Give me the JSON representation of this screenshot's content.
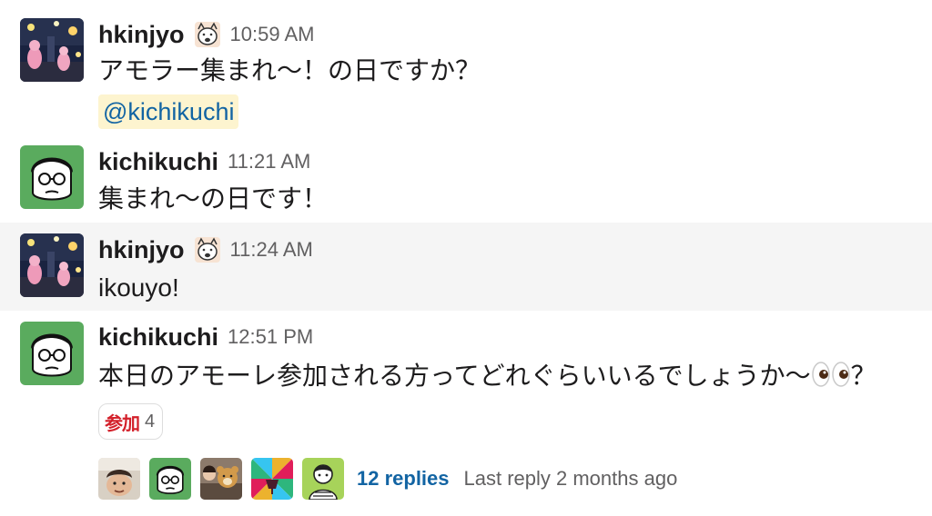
{
  "messages": [
    {
      "user": "hkinjyo",
      "time": "10:59 AM",
      "text": "アモラー集まれ〜！の日ですか？",
      "mention": "@kichikuchi"
    },
    {
      "user": "kichikuchi",
      "time": "11:21 AM",
      "text": "集まれ〜の日です！"
    },
    {
      "user": "hkinjyo",
      "time": "11:24 AM",
      "text": "ikouyo!"
    },
    {
      "user": "kichikuchi",
      "time": "12:51 PM",
      "text": "本日のアモーレ参加される方ってどれぐらいいるでしょうか〜",
      "text_suffix": "？",
      "inline_emoji": "eyes-emoji",
      "reaction": {
        "emoji_label": "参加",
        "count": "4"
      },
      "thread": {
        "replies": "12 replies",
        "last_reply": "Last reply 2 months ago"
      }
    }
  ],
  "colors": {
    "link": "#1264a3",
    "mention_bg": "#fdf4cf",
    "hover_bg": "#f5f5f5",
    "muted": "#616061",
    "avatar_green": "#5aab5e",
    "reaction_red": "#d3202a"
  },
  "icons": {
    "status": "face-sketch-icon",
    "hkinjyo_avatar": "night-photo-avatar",
    "kichikuchi_avatar": "glasses-face-avatar"
  }
}
